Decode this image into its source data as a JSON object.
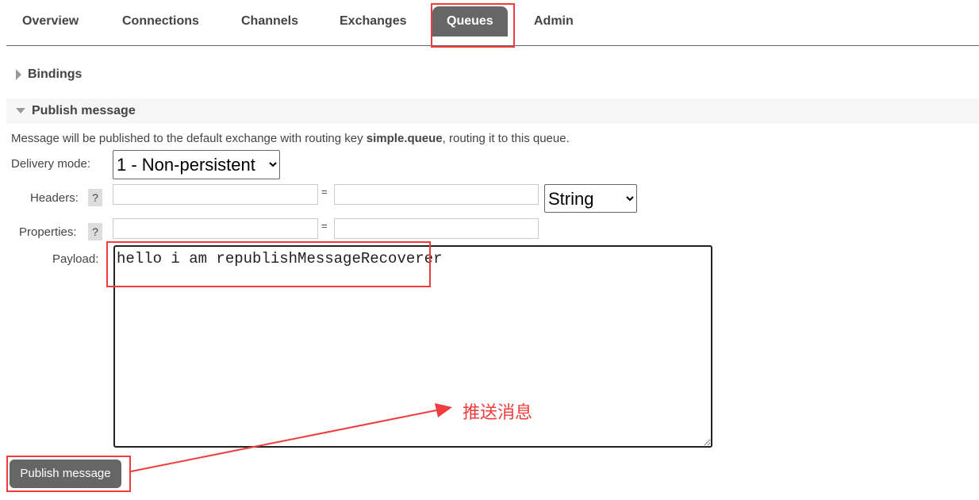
{
  "nav": {
    "tabs": [
      {
        "label": "Overview"
      },
      {
        "label": "Connections"
      },
      {
        "label": "Channels"
      },
      {
        "label": "Exchanges"
      },
      {
        "label": "Queues",
        "active": true
      },
      {
        "label": "Admin"
      }
    ]
  },
  "sections": {
    "bindings": "Bindings",
    "publish": "Publish message"
  },
  "publish": {
    "info_pre": "Message will be published to the default exchange with routing key ",
    "routing_key": "simple.queue",
    "info_post": ", routing it to this queue.",
    "delivery_label": "Delivery mode:",
    "delivery_value": "1 - Non-persistent",
    "headers_label": "Headers:",
    "properties_label": "Properties:",
    "help": "?",
    "equals": "=",
    "header_type": "String",
    "payload_label": "Payload:",
    "payload": "hello i am republishMessageRecoverer",
    "button": "Publish message"
  },
  "annotation": {
    "text": "推送消息",
    "color": "#f03c3c"
  }
}
